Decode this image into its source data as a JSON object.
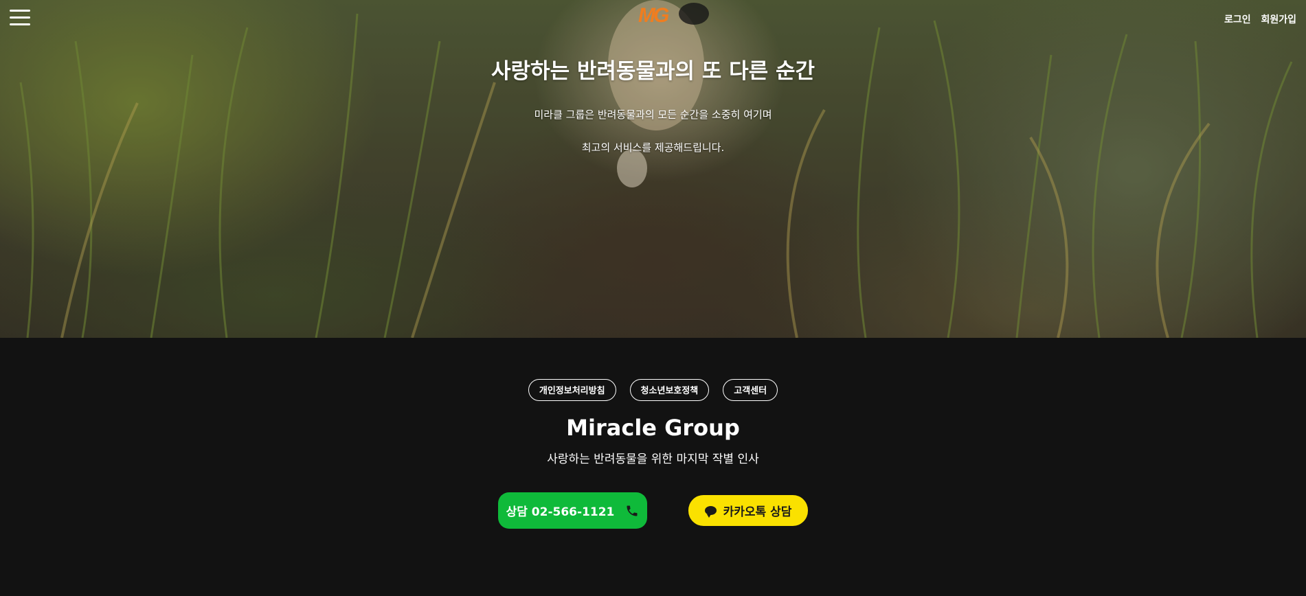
{
  "header": {
    "menu_icon": "hamburger-icon",
    "logo_text": "MG",
    "login_label": "로그인",
    "signup_label": "회원가입"
  },
  "hero": {
    "title": "사랑하는 반려동물과의 또 다른 순간",
    "line1": "미라클 그룹은 반려동물과의 모든 순간을 소중히 여기며",
    "line2": "최고의 서비스를 제공해드립니다."
  },
  "footer": {
    "links": [
      {
        "label": "개인정보처리방침"
      },
      {
        "label": "청소년보호정책"
      },
      {
        "label": "고객센터"
      }
    ],
    "brand": "Miracle Group",
    "tagline": "사랑하는 반려동물을 위한 마지막 작별 인사",
    "phone_cta": "상담 02-566-1121",
    "kakao_cta": "카카오톡 상담"
  },
  "colors": {
    "footer_bg": "#121212",
    "phone_cta_bg": "#0fba3a",
    "kakao_cta_bg": "#fae100",
    "logo": "#f07d1f"
  }
}
